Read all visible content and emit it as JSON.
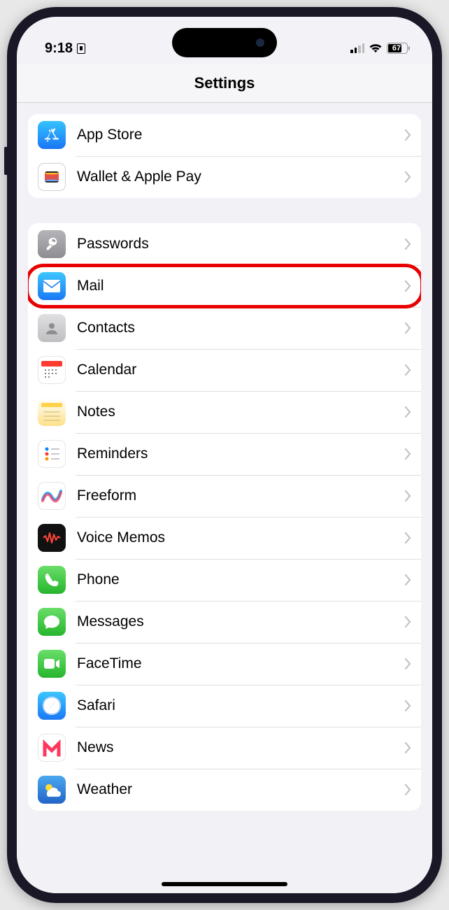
{
  "status": {
    "time": "9:18",
    "battery": "67"
  },
  "header": {
    "title": "Settings"
  },
  "groups": [
    {
      "items": [
        {
          "id": "appstore",
          "label": "App Store"
        },
        {
          "id": "wallet",
          "label": "Wallet & Apple Pay"
        }
      ]
    },
    {
      "items": [
        {
          "id": "passwords",
          "label": "Passwords"
        },
        {
          "id": "mail",
          "label": "Mail",
          "highlighted": true
        },
        {
          "id": "contacts",
          "label": "Contacts"
        },
        {
          "id": "calendar",
          "label": "Calendar"
        },
        {
          "id": "notes",
          "label": "Notes"
        },
        {
          "id": "reminders",
          "label": "Reminders"
        },
        {
          "id": "freeform",
          "label": "Freeform"
        },
        {
          "id": "voicememos",
          "label": "Voice Memos"
        },
        {
          "id": "phone",
          "label": "Phone"
        },
        {
          "id": "messages",
          "label": "Messages"
        },
        {
          "id": "facetime",
          "label": "FaceTime"
        },
        {
          "id": "safari",
          "label": "Safari"
        },
        {
          "id": "news",
          "label": "News"
        },
        {
          "id": "weather",
          "label": "Weather"
        }
      ]
    }
  ]
}
